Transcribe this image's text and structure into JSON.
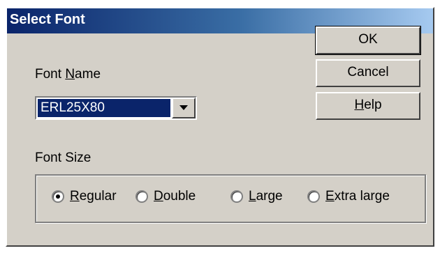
{
  "dialog": {
    "title": "Select Font",
    "font_name_label_pre": "Font ",
    "font_name_label_accel": "N",
    "font_name_label_post": "ame",
    "font_name_value": "ERL25X80",
    "font_size_label": "Font Size"
  },
  "buttons": {
    "ok": "OK",
    "cancel": "Cancel",
    "help_accel": "H",
    "help_rest": "elp"
  },
  "font_size_options": [
    {
      "accel": "R",
      "rest": "egular",
      "selected": true
    },
    {
      "accel": "D",
      "rest": "ouble",
      "selected": false
    },
    {
      "accel": "L",
      "rest": "arge",
      "selected": false
    },
    {
      "accel": "E",
      "rest": "xtra large",
      "selected": false
    }
  ]
}
